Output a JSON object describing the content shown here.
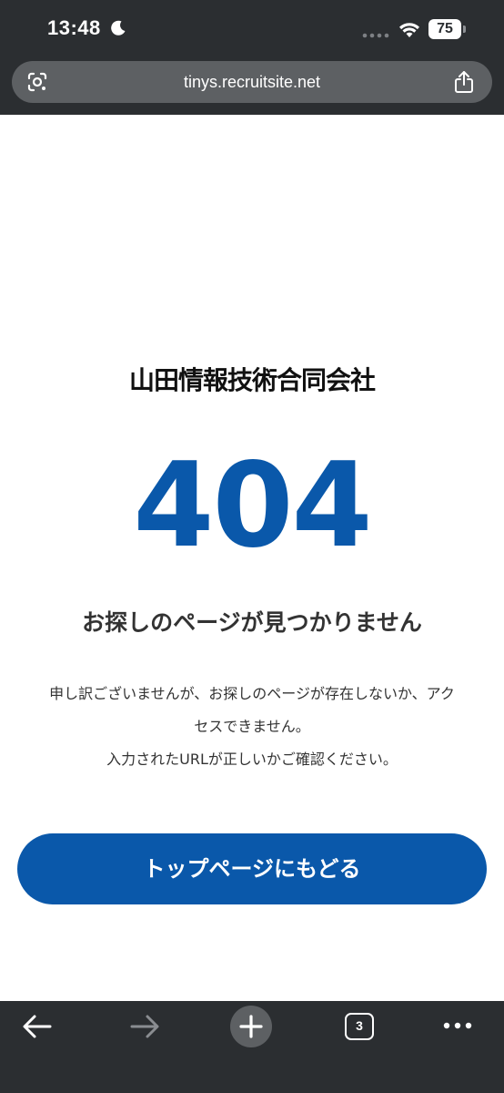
{
  "status_bar": {
    "time": "13:48",
    "battery": "75"
  },
  "browser": {
    "url": "tinys.recruitsite.net"
  },
  "page": {
    "logo_text": "山田情報技術合同会社",
    "error_code": "404",
    "title": "お探しのページが見つかりません",
    "description": [
      "申し訳ございませんが、お探しのページが存在しないか、アク",
      "セスできません。",
      "入力されたURLが正しいかご確認ください。"
    ],
    "button_label": "トップページにもどる"
  },
  "toolbar": {
    "tab_count": "3"
  },
  "colors": {
    "accent": "#0a58aa",
    "chrome": "#2b2e31",
    "url_bar": "#5d6063"
  },
  "icons": [
    "moon-icon",
    "cellular-dots-icon",
    "wifi-icon",
    "battery-icon",
    "google-lens-icon",
    "share-icon",
    "back-arrow-icon",
    "forward-arrow-icon",
    "plus-icon",
    "tabs-icon",
    "more-icon"
  ]
}
